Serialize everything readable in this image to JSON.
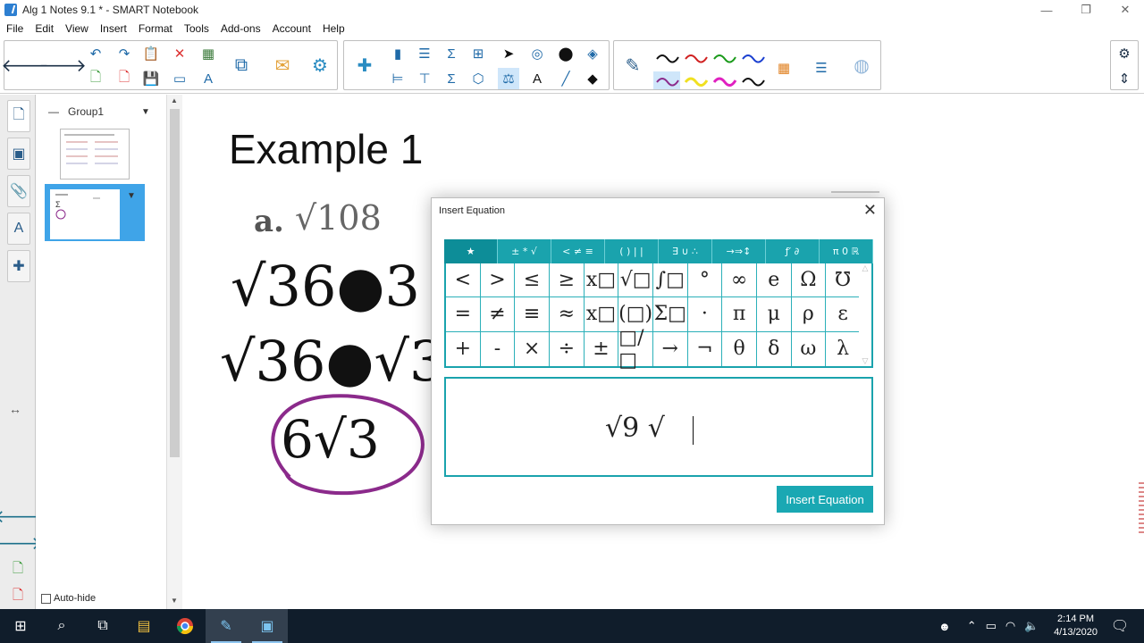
{
  "window": {
    "title": "Alg 1 Notes 9.1 * - SMART Notebook"
  },
  "menu": [
    "File",
    "Edit",
    "View",
    "Insert",
    "Format",
    "Tools",
    "Add-ons",
    "Account",
    "Help"
  ],
  "sidebar": {
    "group": "Group1",
    "autohide_label": "Auto-hide"
  },
  "canvas": {
    "heading": "Example 1",
    "part_label": "a.",
    "problem": "√108",
    "step1": "√36●3",
    "step2": "√36●√3",
    "answer": "6√3"
  },
  "dialog": {
    "title": "Insert Equation",
    "tabs": [
      "★",
      "± * √",
      "< ≠ ≡",
      "( ) | |",
      "∃ ∪ ∴",
      "→⇒↕",
      "ƒ′ ∂",
      "π 0 ℝ"
    ],
    "symbols": [
      [
        "<",
        ">",
        "≤",
        "≥",
        "x□",
        "√□",
        "∫□",
        "°",
        "∞",
        "e",
        "Ω",
        "℧"
      ],
      [
        "=",
        "≠",
        "≡",
        "≈",
        "x□",
        "(□)",
        "Σ□",
        "·",
        "π",
        "μ",
        "ρ",
        "ε"
      ],
      [
        "+",
        "-",
        "×",
        "÷",
        "±",
        "□/□",
        "→",
        "¬",
        "θ",
        "δ",
        "ω",
        "λ"
      ]
    ],
    "editor_expression": "√9 √",
    "insert_button": "Insert Equation"
  },
  "taskbar": {
    "time": "2:14 PM",
    "date": "4/13/2020"
  },
  "colors": {
    "accent": "#1aa3ad",
    "highlight_circle": "#8b2a8b",
    "selected_page": "#3fa4e8"
  }
}
